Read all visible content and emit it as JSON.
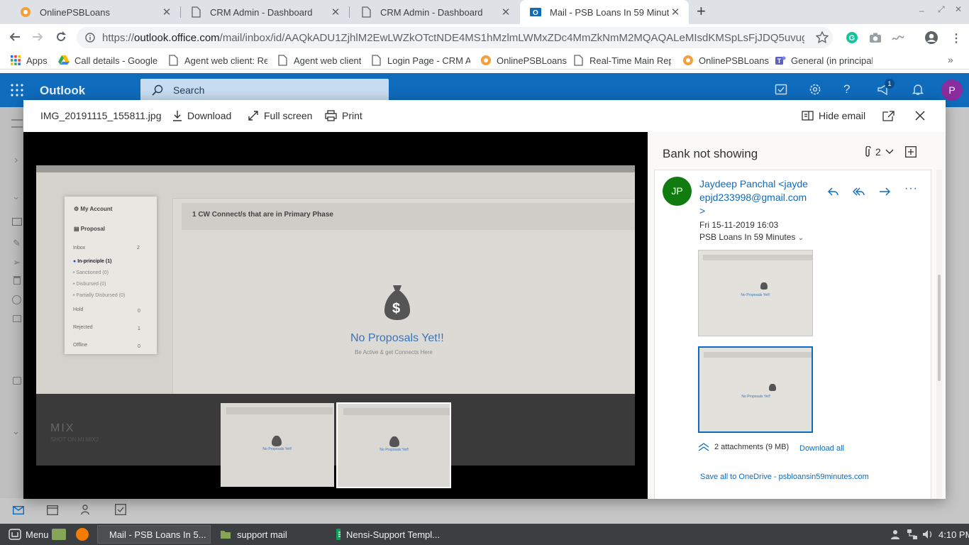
{
  "browser": {
    "tabs": [
      {
        "title": "OnlinePSBLoans"
      },
      {
        "title": "CRM Admin - Dashboard"
      },
      {
        "title": "CRM Admin - Dashboard"
      },
      {
        "title": "Mail - PSB Loans In 59 Minutes"
      }
    ],
    "url_prefix": "https://",
    "url_host": "outlook.office.com",
    "url_path": "/mail/inbox/id/AAQkADU1ZjhlM2EwLWZkOTctNDE4MS1hMzlmLWMxZDc4MmZkNmM2MQAQALeMIsdKMSpLsFjJDQ5uvug...",
    "bookmarks": [
      "Apps",
      "Call details - Google",
      "Agent web client: Re",
      "Agent web client",
      "Login Page - CRM Ac",
      "OnlinePSBLoans",
      "Real-Time Main Rep",
      "OnlinePSBLoans",
      "General (in principal"
    ],
    "notification_count": "1",
    "profile_initial": "P"
  },
  "outlook": {
    "app_name": "Outlook",
    "search_placeholder": "Search",
    "badge": "1",
    "avatar": "P"
  },
  "viewer": {
    "filename": "IMG_20191115_155811.jpg",
    "download": "Download",
    "fullscreen": "Full screen",
    "print": "Print",
    "hide_email": "Hide email"
  },
  "photo": {
    "menu": [
      "My Account",
      "Proposal"
    ],
    "rows": [
      {
        "label": "Inbox",
        "count": "2"
      },
      {
        "label": "In-principle (1)",
        "count": ""
      },
      {
        "label": "Sanctioned (0)",
        "count": ""
      },
      {
        "label": "Disbursed (0)",
        "count": ""
      },
      {
        "label": "Partially Disbursed (0)",
        "count": ""
      },
      {
        "label": "Hold",
        "count": "0"
      },
      {
        "label": "Rejected",
        "count": "1"
      },
      {
        "label": "Offline",
        "count": "0"
      }
    ],
    "banner": "1 CW Connect/s that are in Primary Phase",
    "empty_title": "No Proposals Yet!!",
    "empty_sub": "Be Active & get Connects Here",
    "watermark": "MIX",
    "watermark_sub": "SHOT ON MI MIX2"
  },
  "email": {
    "subject": "Bank not showing",
    "attach_count": "2",
    "avatar": "JP",
    "sender_line1": "Jaydeep Panchal <jayde",
    "sender_line2": "epjd233998@gmail.com",
    "sender_line3": ">",
    "date": "Fri 15-11-2019 16:03",
    "to": "PSB Loans In 59 Minutes",
    "attachments_summary": "2 attachments (9 MB)",
    "download_all": "Download all",
    "save_onedrive": "Save all to OneDrive - psbloansin59minutes.com"
  },
  "taskbar": {
    "menu": "Menu",
    "windows": [
      "Mail - PSB Loans In 5...",
      "support mail",
      "Nensi-Support Templ..."
    ],
    "time": "4:10 PM"
  },
  "colors": {
    "outlook_blue": "#0f6cbd",
    "avatar_green": "#107c10",
    "profile_purple": "#8a2d9e"
  }
}
